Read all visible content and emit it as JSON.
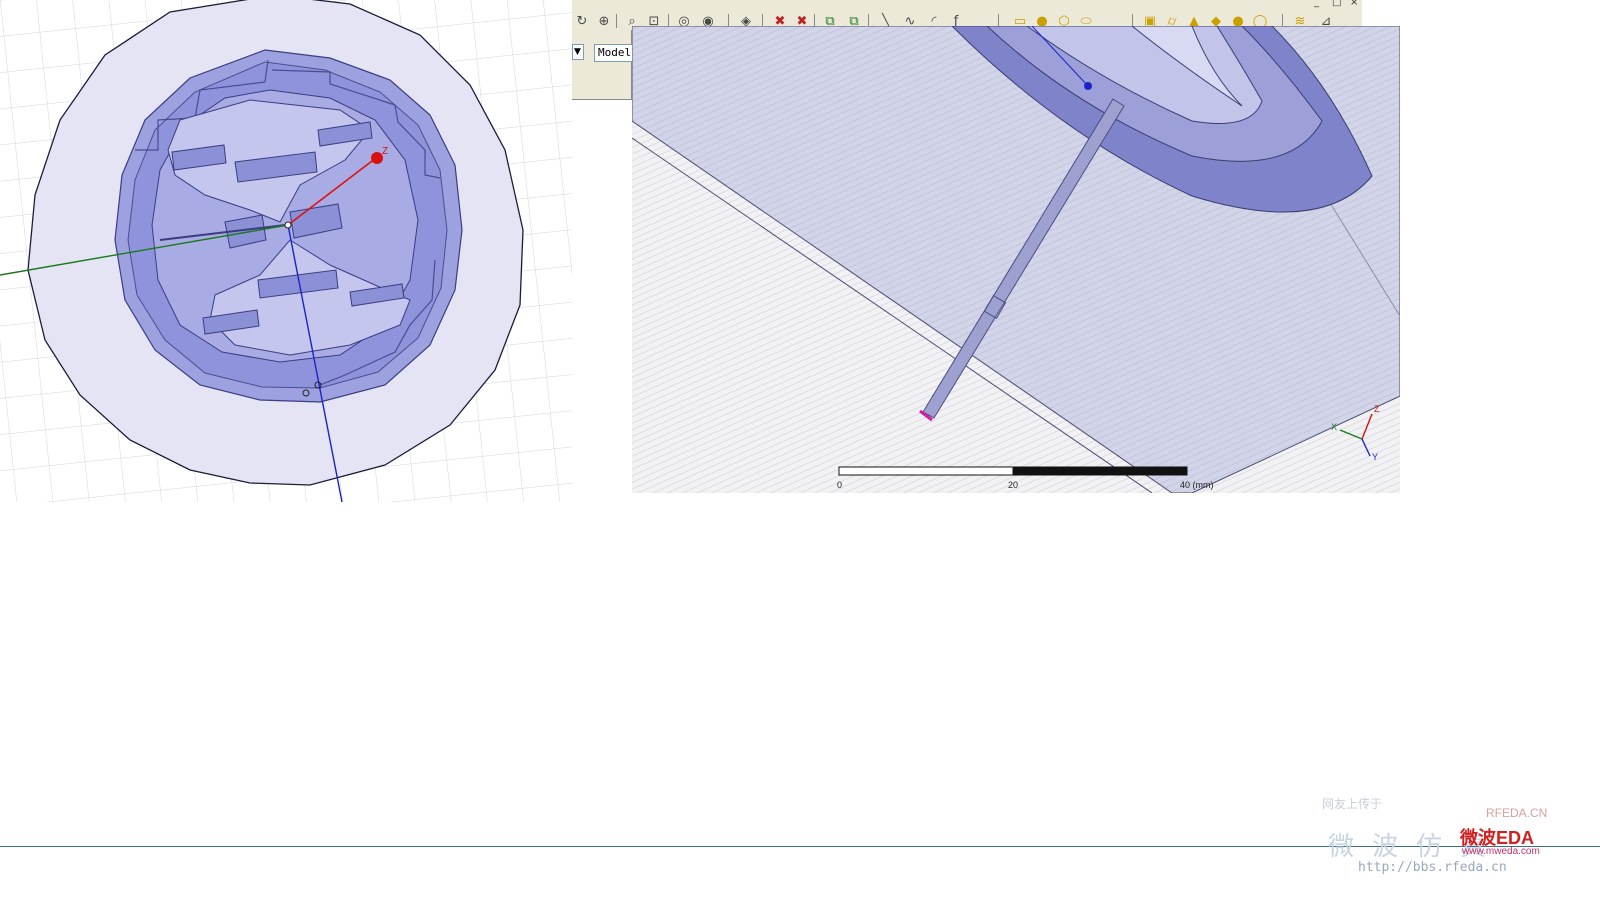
{
  "toolbar": {
    "icons": [
      "rotate-icon",
      "fit-all-icon",
      "zoom-in-icon",
      "zoom-region-icon",
      "orbit-icon",
      "pan-icon",
      "view-icon",
      "delete-x-icon",
      "delete-x2-icon",
      "boolean-icon",
      "boolean2-icon",
      "draw-line-icon",
      "draw-spline-icon",
      "draw-arc-icon",
      "draw-equation-icon",
      "draw-rect-icon",
      "draw-circle-icon",
      "draw-polygon-icon",
      "draw-ellipse-icon",
      "draw-box-icon",
      "draw-cylinder-icon",
      "draw-cone-icon",
      "draw-prism-icon",
      "draw-sphere-icon",
      "draw-torus-icon",
      "draw-helix-icon",
      "measure-icon"
    ],
    "window_controls": [
      "_",
      "□",
      "×"
    ]
  },
  "model_selector": {
    "value": "Model",
    "dropdown_glyph": "▼"
  },
  "left_view": {
    "axis_z_label": "Z",
    "colors": {
      "substrate": "#e3e3f3",
      "patch": "#8a8fd8",
      "axis_x": "#1a7a1a",
      "axis_y": "#1b23c8",
      "axis_z": "#e01010"
    }
  },
  "right_view": {
    "axes": {
      "x": "X",
      "y": "Y",
      "z": "Z"
    },
    "scale_bar": {
      "labels": [
        "0",
        "20",
        "40 (mm)"
      ]
    }
  },
  "watermark": {
    "line1": "网友上传于",
    "line2": "RFEDA.CN",
    "line3": "微波仿真",
    "line4": "微波EDA",
    "line5": "www.mweda.com",
    "line6": "http://bbs.rfeda.cn"
  }
}
